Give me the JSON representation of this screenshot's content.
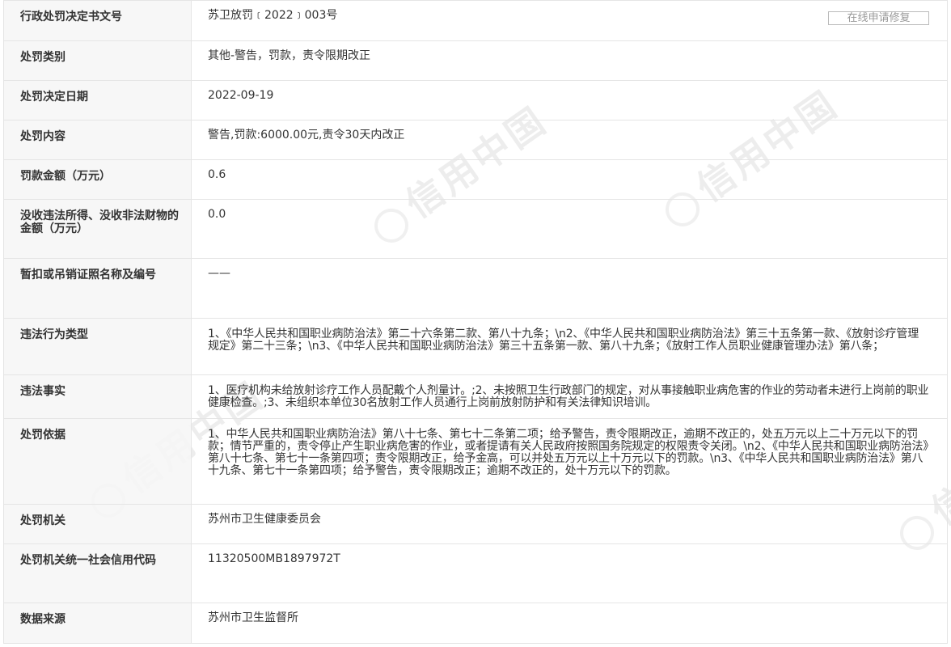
{
  "rows": [
    {
      "label": "行政处罚决定书文号",
      "value": "苏卫放罚﹝2022﹞003号"
    },
    {
      "label": "处罚类别",
      "value": "其他-警告，罚款，责令限期改正"
    },
    {
      "label": "处罚决定日期",
      "value": "2022-09-19"
    },
    {
      "label": "处罚内容",
      "value": "警告,罚款:6000.00元,责令30天内改正"
    },
    {
      "label": "罚款金额（万元）",
      "value": "0.6"
    },
    {
      "label": "没收违法所得、没收非法财物的金额（万元）",
      "value": "0.0"
    },
    {
      "label": "暂扣或吊销证照名称及编号",
      "value": "——"
    },
    {
      "label": "违法行为类型",
      "value": "1、《中华人民共和国职业病防治法》第二十六条第二款、第八十九条；\\n2、《中华人民共和国职业病防治法》第三十五条第一款、《放射诊疗管理规定》第二十三条；\\n3、《中华人民共和国职业病防治法》第三十五条第一款、第八十九条；《放射工作人员职业健康管理办法》第八条；"
    },
    {
      "label": "违法事实",
      "value": "1、医疗机构未给放射诊疗工作人员配戴个人剂量计。;2、未按照卫生行政部门的规定，对从事接触职业病危害的作业的劳动者未进行上岗前的职业健康检查。;3、未组织本单位30名放射工作人员通行上岗前放射防护和有关法律知识培训。"
    },
    {
      "label": "处罚依据",
      "value": "1、中华人民共和国职业病防治法》第八十七条、第七十二条第二项；给予警告，责令限期改正，逾期不改正的，处五万元以上二十万元以下的罚款；情节严重的，责令停止产生职业病危害的作业，或者提请有关人民政府按照国务院规定的权限责令关闭。\\n2、《中华人民共和国职业病防治法》第八十七条、第七十一条第四项；责令限期改正，给予金高，可以并处五万元以上十万元以下的罚款。\\n3、《中华人民共和国职业病防治法》第八十九条、第七十一条第四项；给予警告，责令限期改正；逾期不改正的，处十万元以下的罚款。"
    },
    {
      "label": "处罚机关",
      "value": "苏州市卫生健康委员会"
    },
    {
      "label": "处罚机关统一社会信用代码",
      "value": "11320500MB1897972T"
    },
    {
      "label": "数据来源",
      "value": "苏州市卫生监督所"
    }
  ],
  "repair_button": "在线申请修复",
  "watermark": "信用中国"
}
